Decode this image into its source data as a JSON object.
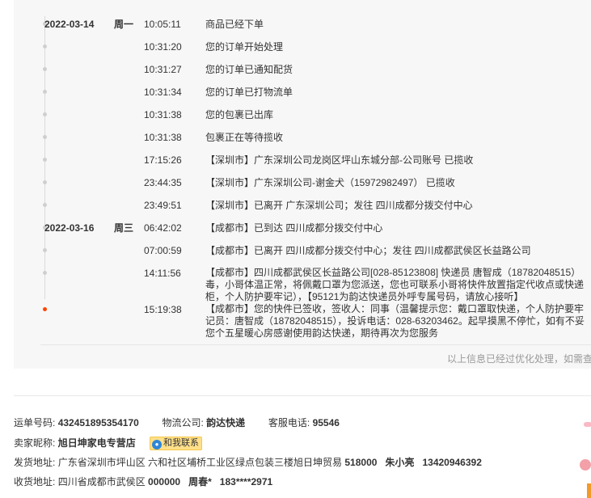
{
  "tracking": {
    "events": [
      {
        "date": "2022-03-14",
        "weekday": "周一",
        "time": "10:05:11",
        "message": "商品已经下单"
      },
      {
        "date": "",
        "weekday": "",
        "time": "10:31:20",
        "message": "您的订单开始处理"
      },
      {
        "date": "",
        "weekday": "",
        "time": "10:31:27",
        "message": "您的订单已通知配货"
      },
      {
        "date": "",
        "weekday": "",
        "time": "10:31:34",
        "message": "您的订单已打物流单"
      },
      {
        "date": "",
        "weekday": "",
        "time": "10:31:38",
        "message": "您的包裹已出库"
      },
      {
        "date": "",
        "weekday": "",
        "time": "10:31:38",
        "message": "包裹正在等待揽收"
      },
      {
        "date": "",
        "weekday": "",
        "time": "17:15:26",
        "message": "【深圳市】广东深圳公司龙岗区坪山东城分部-公司账号 已揽收"
      },
      {
        "date": "",
        "weekday": "",
        "time": "23:44:35",
        "message": "【深圳市】广东深圳公司-谢金犬（15972982497） 已揽收"
      },
      {
        "date": "",
        "weekday": "",
        "time": "23:49:51",
        "message": "【深圳市】已离开 广东深圳公司；发往 四川成都分拨交付中心"
      },
      {
        "date": "2022-03-16",
        "weekday": "周三",
        "time": "06:42:02",
        "message": "【成都市】已到达 四川成都分拨交付中心"
      },
      {
        "date": "",
        "weekday": "",
        "time": "07:00:59",
        "message": "【成都市】已离开 四川成都分拨交付中心；发往 四川成都武侯区长益路公司"
      },
      {
        "date": "",
        "weekday": "",
        "time": "14:11:56",
        "message": "【成都市】四川成都武侯区长益路公司[028-85123808] 快递员 唐智成（18782048515）毒，小哥体温正常，将佩戴口罩为您派送，您也可联系小哥将快件放置指定代收点或快递柜，个人防护要牢记），【95121为韵达快递员外呼专属号码，请放心接听】"
      },
      {
        "date": "",
        "weekday": "",
        "time": "15:19:38",
        "message": "【成都市】您的快件已签收，签收人：同事（温馨提示您：戴口罩取快递，个人防护要牢记员：唐智成（18782048515），投诉电话：028-63203462。起早摸黑不停忙，如有不妥您个五星暖心房感谢使用韵达快递，期待再次为您服务"
      }
    ],
    "footer_note": "以上信息已经过优化处理，如需查"
  },
  "shipment": {
    "tracking_no_label": "运单号码:",
    "tracking_no": "432451895354170",
    "carrier_label": "物流公司:",
    "carrier": "韵达快递",
    "hotline_label": "客服电话:",
    "hotline": "95546",
    "seller_label": "卖家昵称:",
    "seller": "旭日坤家电专营店",
    "contact_button": "和我联系",
    "from_label": "发货地址:",
    "from_address": "广东省深圳市坪山区 六和社区埔桥工业区绿点包装三楼旭日坤贸易",
    "from_zip": "518000",
    "from_name": "朱小亮",
    "from_phone": "13420946392",
    "to_label": "收货地址:",
    "to_address": "四川省成都市武侯区",
    "to_zip": "000000",
    "to_name": "周春*",
    "to_phone": "183****2971"
  },
  "colors": {
    "latest_dot": "#ff4400",
    "track_bg": "#f7f7f7",
    "contact_bg": "#ffe08a"
  }
}
